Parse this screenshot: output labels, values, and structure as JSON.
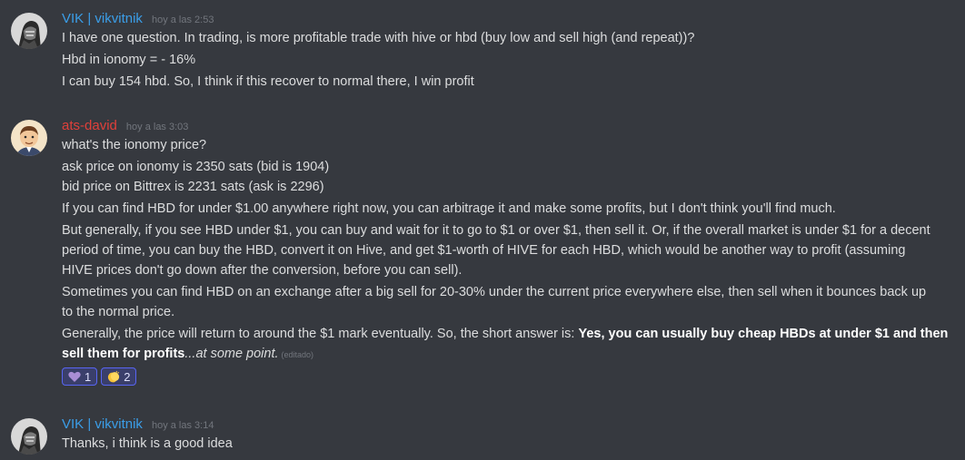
{
  "messages": [
    {
      "username": "VIK | vikvitnik",
      "user_color": "#3b9ee8",
      "timestamp": "hoy a las 2:53",
      "avatar": "vik-avatar",
      "lines": [
        "I have one question. In trading, is more profitable trade with hive or hbd (buy low and sell high (and repeat))?",
        "Hbd in ionomy = - 16%",
        "I can buy 154 hbd. So, I think if this recover to normal there, I win profit"
      ]
    },
    {
      "username": "ats-david",
      "user_color": "#e0403a",
      "timestamp": "hoy a las 3:03",
      "avatar": "david-avatar",
      "lines": [
        "what's the ionomy price?",
        "ask price on ionomy is 2350 sats (bid is 1904)",
        "bid price on Bittrex is 2231 sats (ask is 2296)",
        "If you can find HBD for under $1.00 anywhere right now, you can arbitrage it and make some profits, but I don't think you'll find much.",
        "But generally, if you see HBD under $1, you can buy and wait for it to go to $1 or over $1, then sell it. Or, if the overall market is under $1 for a decent",
        "period of time, you can buy the HBD, convert it on Hive, and get $1-worth of HIVE for each HBD, which would be another way to profit (assuming",
        "HIVE prices don't go down after the conversion, before you can sell).",
        "Sometimes you can find HBD on an exchange after a big sell for 20-30% under the current price everywhere else, then sell when it bounces back up",
        "to the normal price."
      ],
      "final": {
        "prefix": "Generally, the price will return to around the $1 mark eventually. So, the short answer is: ",
        "bold1": "Yes, you can usually buy cheap HBDs at under $1 and then",
        "bold2": "sell them for profits",
        "italic": "...at some point.",
        "edited": "(editado)"
      },
      "reactions": [
        {
          "icon": "purple-heart-icon",
          "count": "1"
        },
        {
          "icon": "clapping-hands-icon",
          "count": "2"
        }
      ]
    },
    {
      "username": "VIK | vikvitnik",
      "user_color": "#3b9ee8",
      "timestamp": "hoy a las 3:14",
      "avatar": "vik-avatar",
      "lines": [
        "Thanks, i think is a good idea"
      ]
    }
  ]
}
